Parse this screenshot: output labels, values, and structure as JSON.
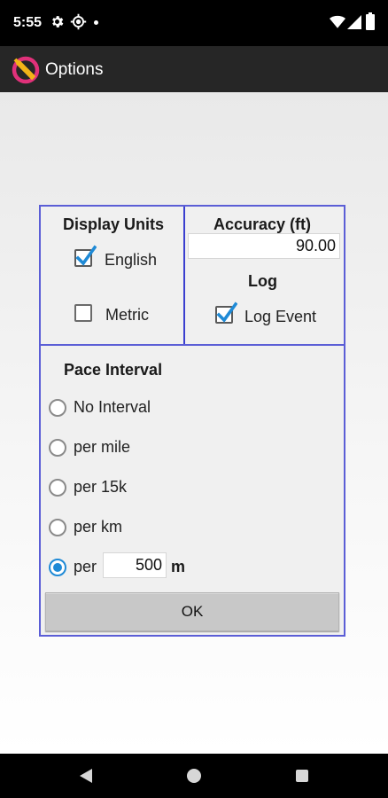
{
  "status_bar": {
    "time": "5:55",
    "icons": [
      "gear-icon",
      "location-target-icon",
      "notification-dot-icon",
      "wifi-icon",
      "signal-icon",
      "battery-icon"
    ]
  },
  "app_bar": {
    "title": "Options",
    "logo": "app-logo-icon"
  },
  "display_units": {
    "heading": "Display Units",
    "options": [
      {
        "label": "English",
        "checked": true
      },
      {
        "label": "Metric",
        "checked": false
      }
    ]
  },
  "accuracy": {
    "heading": "Accuracy (ft)",
    "value": "90.00"
  },
  "log": {
    "heading": "Log",
    "option": {
      "label": "Log Event",
      "checked": true
    }
  },
  "pace_interval": {
    "heading": "Pace Interval",
    "options": [
      {
        "label": "No Interval",
        "selected": false
      },
      {
        "label": "per mile",
        "selected": false
      },
      {
        "label": "per 15k",
        "selected": false
      },
      {
        "label": "per km",
        "selected": false
      },
      {
        "label": "per",
        "selected": true
      }
    ],
    "custom_value": "500",
    "custom_unit": "m"
  },
  "ok_label": "OK",
  "colors": {
    "panel_border": "#5b5ed6",
    "accent": "#1f8ad6",
    "app_bar": "#262626"
  }
}
